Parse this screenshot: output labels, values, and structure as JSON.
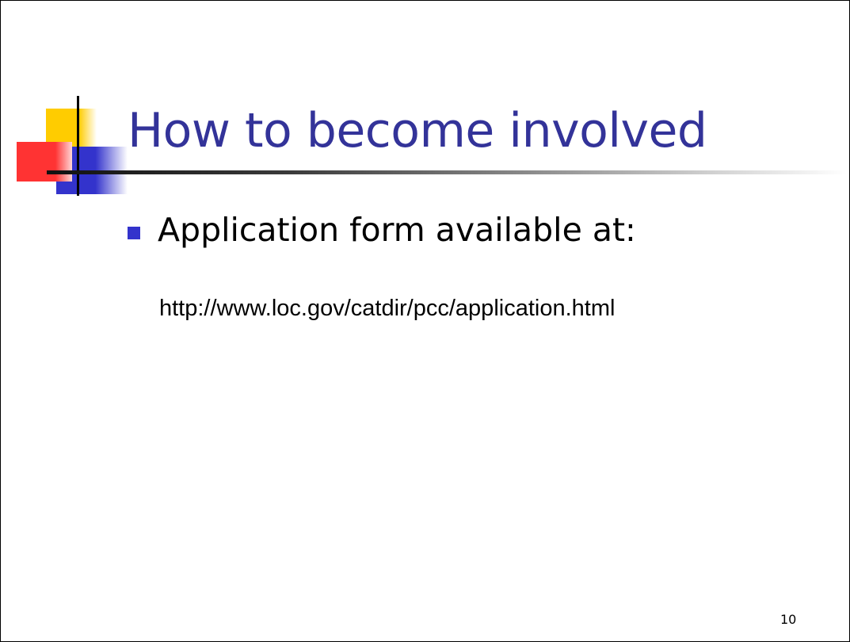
{
  "slide": {
    "title": "How to become involved",
    "bullets": [
      {
        "text": "Application form available at:"
      }
    ],
    "url": "http://www.loc.gov/catdir/pcc/application.html",
    "page_number": "10"
  },
  "colors": {
    "title": "#333399",
    "bullet_marker": "#3333cc",
    "logo_yellow": "#ffcc00",
    "logo_red": "#ff3333",
    "logo_blue": "#3333cc",
    "text": "#000000"
  },
  "icons": {
    "logo": "corner-squares-logo",
    "bullet": "square-bullet"
  }
}
